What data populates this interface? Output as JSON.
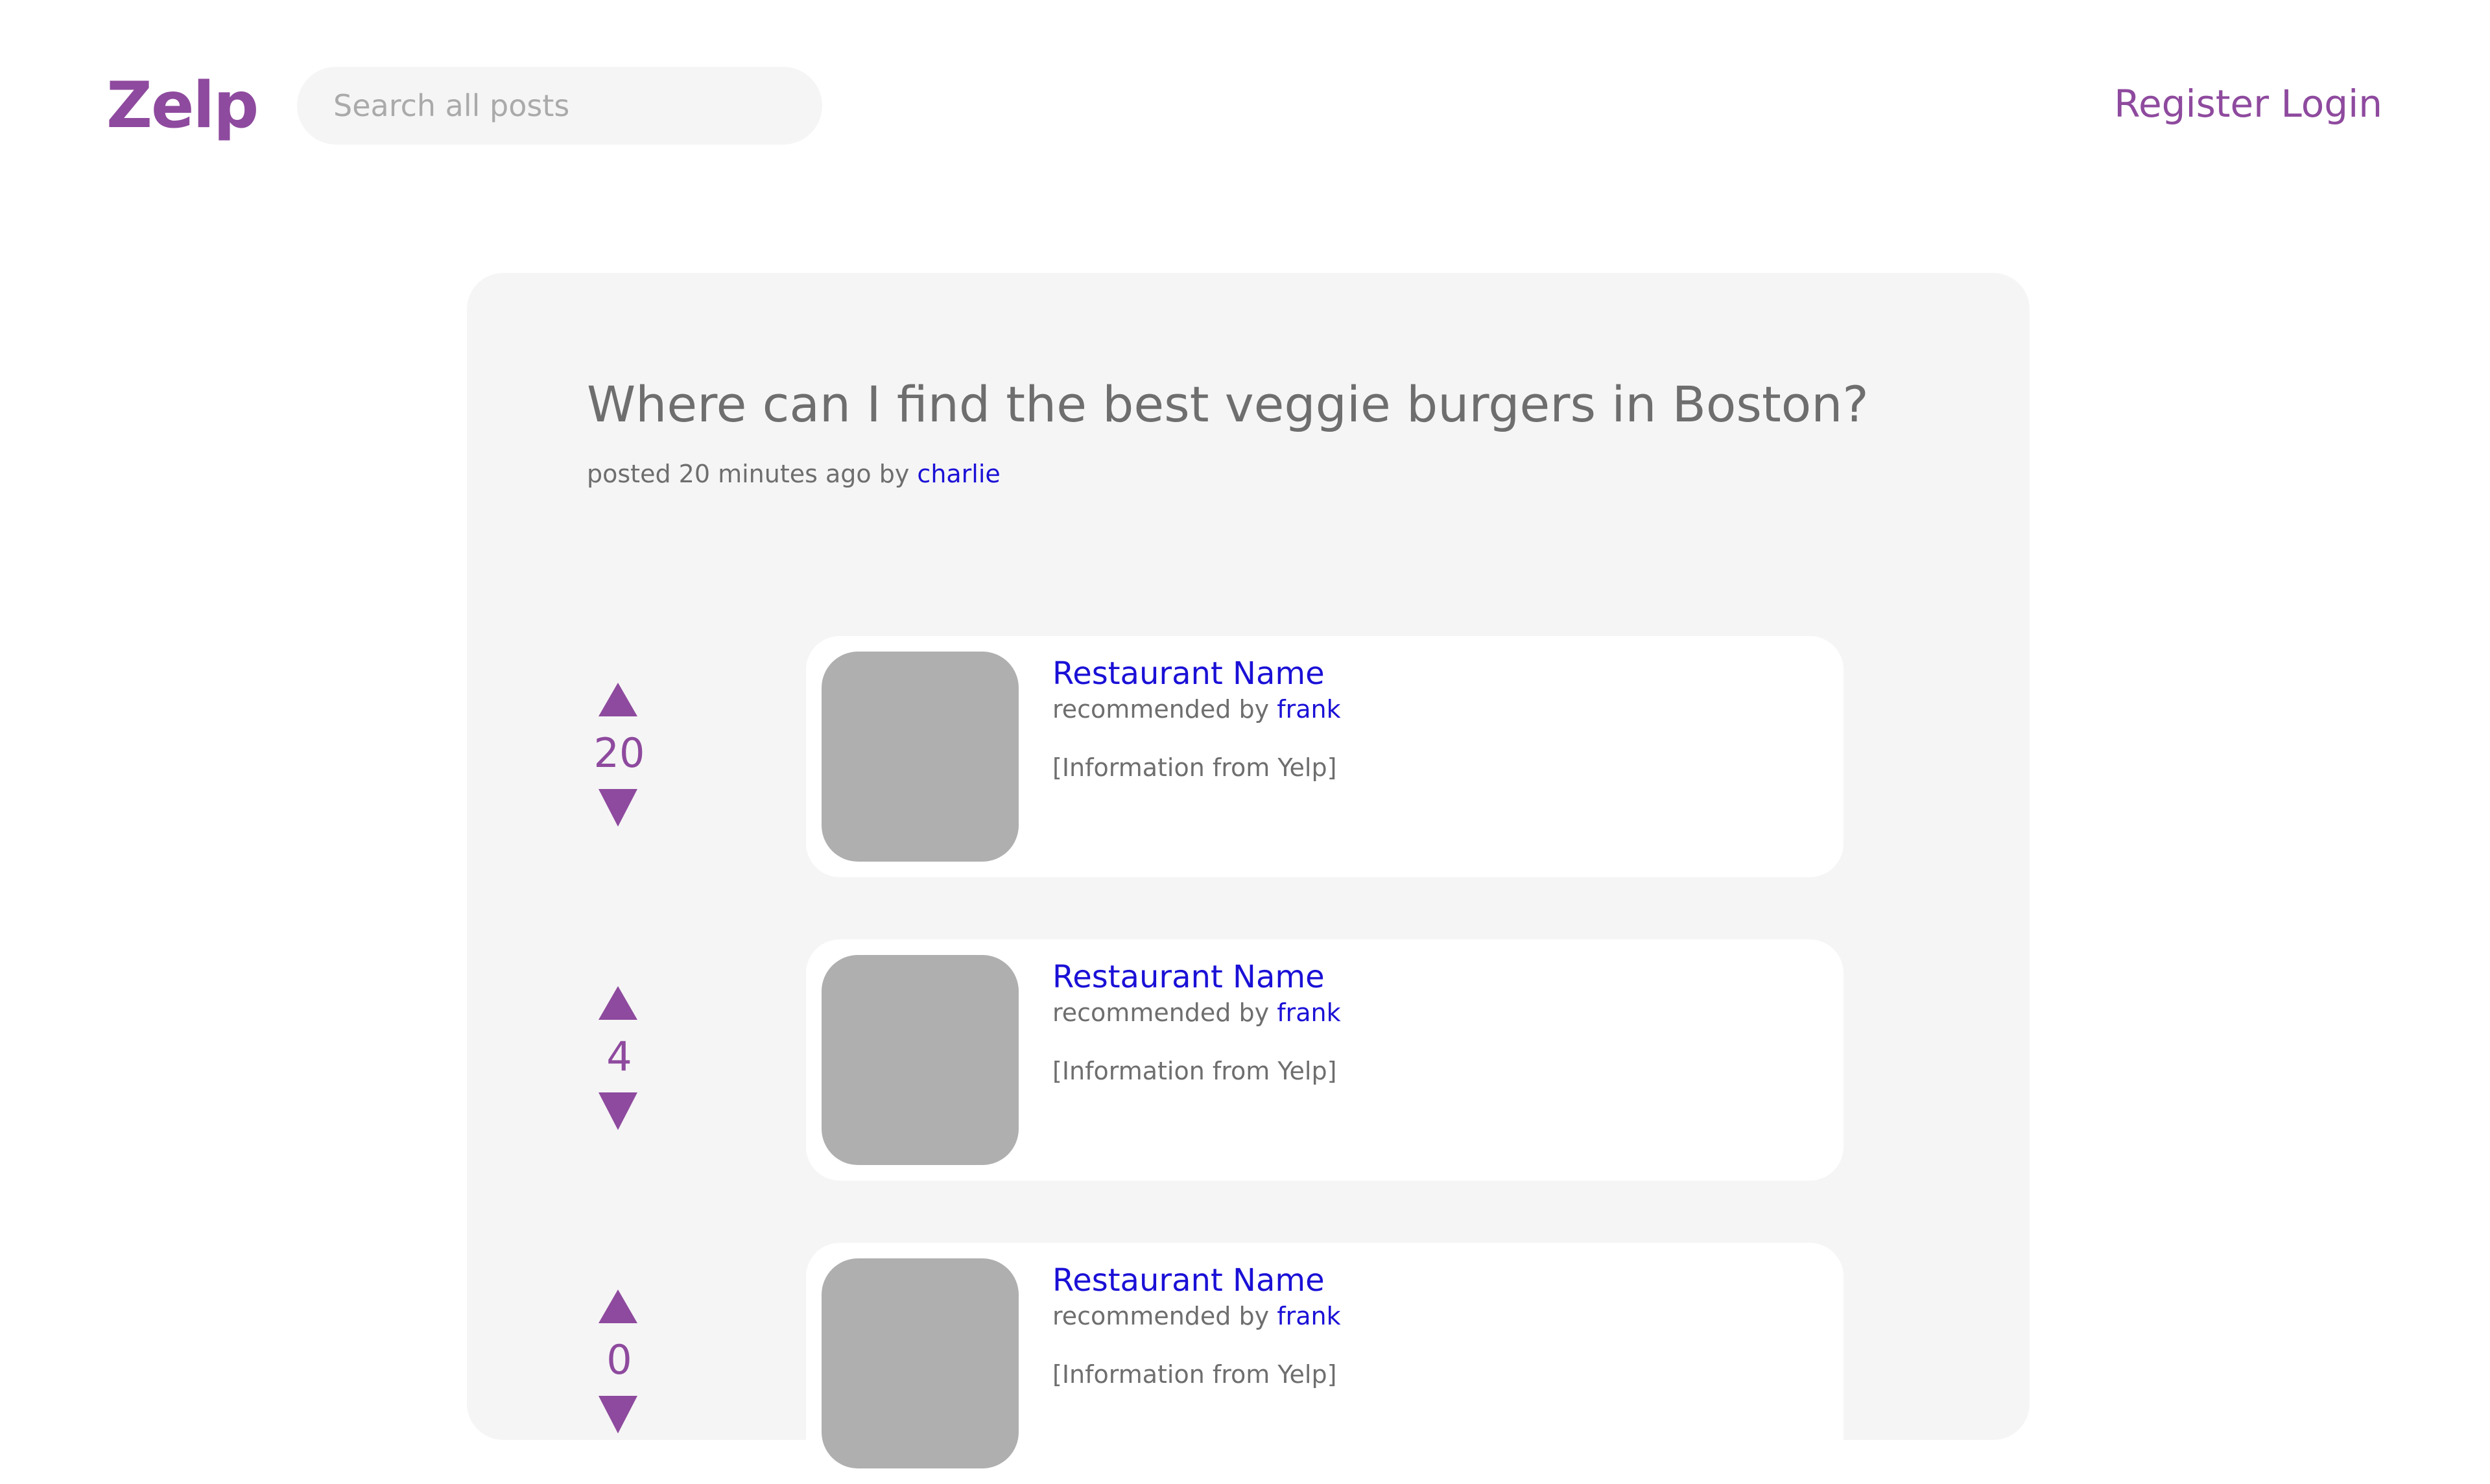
{
  "header": {
    "logo": "Zelp",
    "search_placeholder": "Search all posts",
    "register_label": "Register",
    "login_label": "Login"
  },
  "post": {
    "title": "Where can I find the best veggie burgers in Boston?",
    "meta_prefix": "posted 20 minutes ago by",
    "author": "charlie"
  },
  "recommendations": [
    {
      "votes": "20",
      "name": "Restaurant Name",
      "by_prefix": "recommended by",
      "by_user": "frank",
      "info": "[Information from Yelp]"
    },
    {
      "votes": "4",
      "name": "Restaurant Name",
      "by_prefix": "recommended by",
      "by_user": "frank",
      "info": "[Information from Yelp]"
    },
    {
      "votes": "0",
      "name": "Restaurant Name",
      "by_prefix": "recommended by",
      "by_user": "frank",
      "info": "[Information from Yelp]"
    }
  ],
  "colors": {
    "brand": "#8e4a9e",
    "link": "#1a10d6",
    "panel": "#f5f5f5",
    "thumbnail": "#b0afaf"
  },
  "icons": {
    "upvote": "upvote-arrow-icon",
    "downvote": "downvote-arrow-icon"
  }
}
